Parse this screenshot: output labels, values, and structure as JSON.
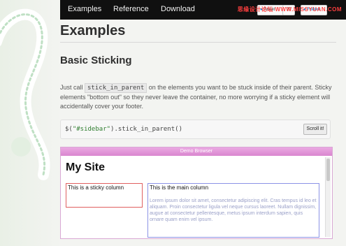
{
  "nav": {
    "examples": "Examples",
    "reference": "Reference",
    "download": "Download"
  },
  "social": {
    "tweet_label": "Tweet",
    "tweet_count": "99",
    "follow_label": "Follow"
  },
  "watermark": "思缘设计论坛 WWW.MISSYUAN.COM",
  "page": {
    "title": "Examples",
    "section_title": "Basic Sticking",
    "para_part1": "Just call ",
    "para_code": "stick_in_parent",
    "para_part2": " on the elements you want to be stuck inside of their parent. Sticky elements \"bottom out\" so they never leave the container, no more worrying if a sticky element will accidentally cover your footer."
  },
  "code": {
    "prefix": "$(",
    "string": "\"#sidebar\"",
    "suffix": ").stick_in_parent()",
    "scroll_button": "Scroll it!"
  },
  "demo": {
    "browser_title": "Demo Browser",
    "site_title": "My Site",
    "sticky_text": "This is a sticky column",
    "main_text": "This is the main column",
    "lorem": "Lorem ipsum dolor sit amet, consectetur adipiscing elit. Cras tempus id leo et aliquam. Proin consectetur ligula vel neque cursus laoreet. Nullam dignissim, augue at consectetur pellentesque, metus ipsum interdum sapien, quis ornare quam enim vel ipsum."
  },
  "colors": {
    "nav_bg": "#101010",
    "demo_title_bar": "#e49ad9",
    "sticky_border": "#e06060",
    "main_border": "#8b93e6"
  }
}
